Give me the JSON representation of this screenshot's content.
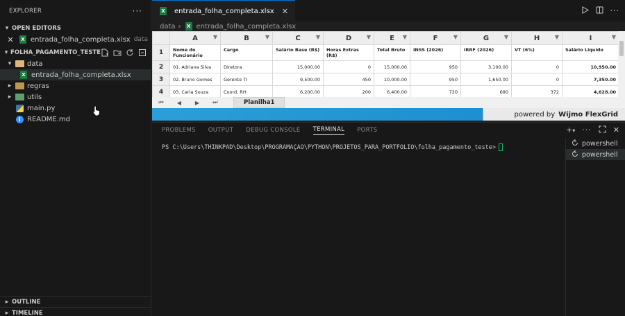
{
  "explorer": {
    "title": "EXPLORER",
    "more": "···",
    "open_editors": {
      "label": "OPEN EDITORS",
      "items": [
        {
          "name": "entrada_folha_completa.xlsx",
          "path": "data"
        }
      ]
    },
    "project": {
      "label": "FOLHA_PAGAMENTO_TESTE",
      "tree": [
        {
          "label": "data",
          "kind": "folder-open",
          "level": 0
        },
        {
          "label": "entrada_folha_completa.xlsx",
          "kind": "xlsx",
          "level": 1
        },
        {
          "label": "regras",
          "kind": "folder",
          "level": 0
        },
        {
          "label": "utils",
          "kind": "folder",
          "level": 0
        },
        {
          "label": "main.py",
          "kind": "python",
          "level": 0
        },
        {
          "label": "README.md",
          "kind": "info",
          "level": 0
        }
      ]
    },
    "outline": "OUTLINE",
    "timeline": "TIMELINE"
  },
  "editor": {
    "tab_label": "entrada_folha_completa.xlsx",
    "breadcrumb": [
      "data",
      "entrada_folha_completa.xlsx"
    ]
  },
  "grid": {
    "columns": [
      "A",
      "B",
      "C",
      "D",
      "E",
      "F",
      "G",
      "H",
      "I"
    ],
    "row_numbers": [
      "1",
      "2",
      "3",
      "4"
    ],
    "headers": [
      "Nome do Funcionário",
      "Cargo",
      "Salário Base (R$)",
      "Horas Extras (R$)",
      "Total Bruto",
      "INSS (2026)",
      "IRRF (2026)",
      "VT (6%)",
      "Salário Líquido"
    ],
    "rows": [
      [
        "01. Adriana Silva",
        "Diretora",
        "15,000.00",
        "0",
        "15,000.00",
        "950",
        "3,100.00",
        "0",
        "10,950.00"
      ],
      [
        "02. Bruno Gomes",
        "Gerente TI",
        "9,500.00",
        "450",
        "10,000.00",
        "950",
        "1,650.00",
        "0",
        "7,350.00"
      ],
      [
        "03. Carla Souza",
        "Coord. RH",
        "6,200.00",
        "200",
        "6,400.00",
        "720",
        "680",
        "372",
        "4,628.00"
      ]
    ],
    "sheet_name": "Planilha1",
    "powered_by": "powered by",
    "brand": "Wijmo FlexGrid"
  },
  "panel": {
    "tabs": [
      "PROBLEMS",
      "OUTPUT",
      "DEBUG CONSOLE",
      "TERMINAL",
      "PORTS"
    ],
    "active_tab": "TERMINAL",
    "prompt": "PS C:\\Users\\THINKPAD\\Desktop\\PROGRAMAÇAO\\PYTHON\\PROJETOS_PARA_PORTFOLIO\\folha_pagamento_teste>",
    "terminals": [
      "powershell",
      "powershell"
    ]
  }
}
